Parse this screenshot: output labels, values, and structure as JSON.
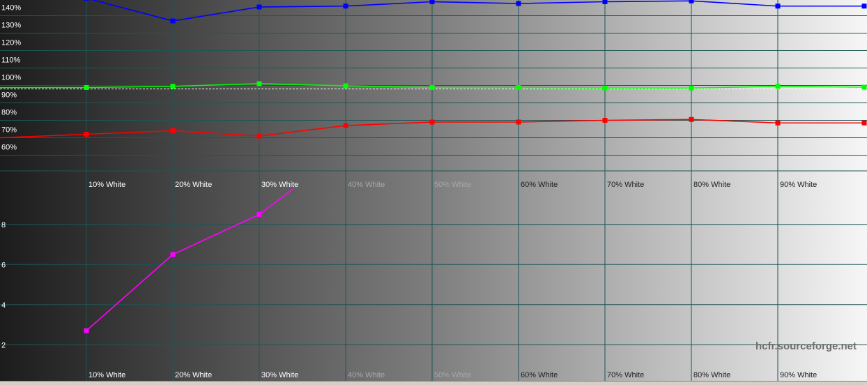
{
  "chart_data": [
    {
      "type": "line",
      "panel": "rgb-levels",
      "categories": [
        "",
        "10% White",
        "20% White",
        "30% White",
        "40% White",
        "50% White",
        "60% White",
        "70% White",
        "80% White",
        "90% White",
        ""
      ],
      "x": [
        0,
        10,
        20,
        30,
        40,
        50,
        60,
        70,
        80,
        90,
        100
      ],
      "y_tick_labels": [
        "60%",
        "70%",
        "80%",
        "90%",
        "100%",
        "110%",
        "120%",
        "130%",
        "140%"
      ],
      "y_ticks": [
        60,
        70,
        80,
        90,
        100,
        110,
        120,
        130,
        140
      ],
      "ylim": [
        51,
        149
      ],
      "reference_line": 98,
      "series": [
        {
          "color": "#0000ff",
          "x": [
            0,
            10,
            20,
            30,
            40,
            50,
            60,
            70,
            80,
            90,
            100
          ],
          "values": [
            160,
            150,
            137,
            145,
            145.5,
            148,
            147,
            148,
            148.5,
            145.5,
            145.5
          ]
        },
        {
          "color": "#00ff00",
          "x": [
            0,
            10,
            20,
            30,
            40,
            50,
            60,
            70,
            80,
            90,
            100
          ],
          "values": [
            98.8,
            98.8,
            99.5,
            101,
            99.8,
            98.8,
            98.8,
            98.5,
            98.5,
            99.5,
            99
          ]
        },
        {
          "color": "#ff0000",
          "x": [
            0,
            10,
            20,
            30,
            40,
            50,
            60,
            70,
            80,
            90,
            100
          ],
          "values": [
            70,
            72,
            74,
            71,
            77,
            79,
            79,
            80,
            80.5,
            78.5,
            78.5
          ]
        }
      ]
    },
    {
      "type": "line",
      "panel": "deltaE",
      "categories": [
        "",
        "10% White",
        "20% White",
        "30% White",
        "40% White",
        "50% White",
        "60% White",
        "70% White",
        "80% White",
        "90% White",
        ""
      ],
      "x": [
        0,
        10,
        20,
        30,
        40,
        50,
        60,
        70,
        80,
        90,
        100
      ],
      "y_tick_labels": [
        "2",
        "4",
        "6",
        "8"
      ],
      "y_ticks": [
        2,
        4,
        6,
        8
      ],
      "ylim": [
        0.2,
        9.8
      ],
      "series": [
        {
          "color": "#ff00ff",
          "x": [
            10,
            20,
            30,
            34
          ],
          "values": [
            2.7,
            6.5,
            8.5,
            9.8
          ]
        }
      ]
    }
  ],
  "watermark": "hcfr.sourceforge.net"
}
